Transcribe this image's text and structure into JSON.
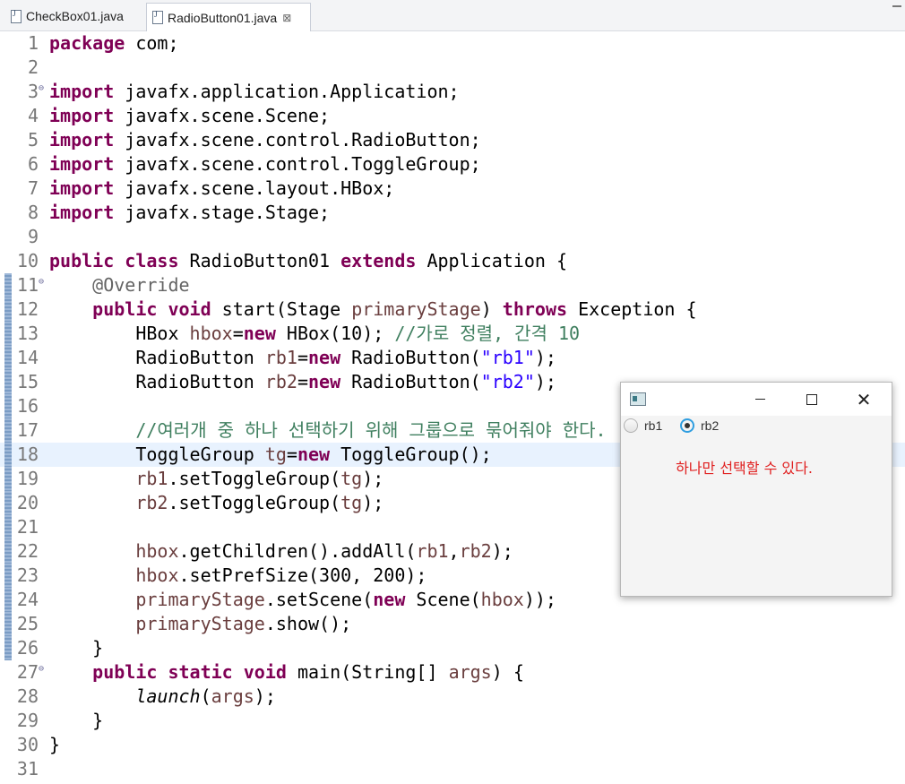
{
  "tabs": [
    {
      "label": "CheckBox01.java",
      "active": false
    },
    {
      "label": "RadioButton01.java",
      "active": true,
      "close": "⊠"
    }
  ],
  "editor": {
    "lines": [
      {
        "no": "1",
        "html": "<span class=\"kw\">package</span> com;"
      },
      {
        "no": "2",
        "html": ""
      },
      {
        "no": "3",
        "fold": true,
        "html": "<span class=\"kw\">import</span> javafx.application.Application;"
      },
      {
        "no": "4",
        "html": "<span class=\"kw\">import</span> javafx.scene.Scene;"
      },
      {
        "no": "5",
        "html": "<span class=\"kw\">import</span> javafx.scene.control.RadioButton;"
      },
      {
        "no": "6",
        "html": "<span class=\"kw\">import</span> javafx.scene.control.ToggleGroup;"
      },
      {
        "no": "7",
        "html": "<span class=\"kw\">import</span> javafx.scene.layout.HBox;"
      },
      {
        "no": "8",
        "html": "<span class=\"kw\">import</span> javafx.stage.Stage;"
      },
      {
        "no": "9",
        "html": ""
      },
      {
        "no": "10",
        "html": "<span class=\"kw\">public</span> <span class=\"kw\">class</span> RadioButton01 <span class=\"kw\">extends</span> Application {"
      },
      {
        "no": "11",
        "fold": true,
        "changed": true,
        "html": "    <span class=\"ann\">@Override</span>"
      },
      {
        "no": "12",
        "changed": true,
        "html": "    <span class=\"kw\">public</span> <span class=\"kw\">void</span> start(Stage <span class=\"var\">primaryStage</span>) <span class=\"kw\">throws</span> Exception {"
      },
      {
        "no": "13",
        "changed": true,
        "html": "        HBox <span class=\"var\">hbox</span>=<span class=\"kw\">new</span> HBox(10); <span class=\"cmt\">//가로 정렬, 간격 10</span>"
      },
      {
        "no": "14",
        "changed": true,
        "html": "        RadioButton <span class=\"var\">rb1</span>=<span class=\"kw\">new</span> RadioButton(<span class=\"str\">\"rb1\"</span>);"
      },
      {
        "no": "15",
        "changed": true,
        "html": "        RadioButton <span class=\"var\">rb2</span>=<span class=\"kw\">new</span> RadioButton(<span class=\"str\">\"rb2\"</span>);"
      },
      {
        "no": "16",
        "changed": true,
        "html": ""
      },
      {
        "no": "17",
        "changed": true,
        "html": "        <span class=\"cmt\">//여러개 중 하나 선택하기 위해 그룹으로 묶어줘야 한다.</span>"
      },
      {
        "no": "18",
        "changed": true,
        "current": true,
        "html": "        ToggleGroup <span class=\"var\">tg</span>=<span class=\"kw\">new</span> ToggleGroup();"
      },
      {
        "no": "19",
        "changed": true,
        "html": "        <span class=\"var\">rb1</span>.setToggleGroup(<span class=\"var\">tg</span>);"
      },
      {
        "no": "20",
        "changed": true,
        "html": "        <span class=\"var\">rb2</span>.setToggleGroup(<span class=\"var\">tg</span>);"
      },
      {
        "no": "21",
        "changed": true,
        "html": ""
      },
      {
        "no": "22",
        "changed": true,
        "html": "        <span class=\"var\">hbox</span>.getChildren().addAll(<span class=\"var\">rb1</span>,<span class=\"var\">rb2</span>);"
      },
      {
        "no": "23",
        "changed": true,
        "html": "        <span class=\"var\">hbox</span>.setPrefSize(300, 200);"
      },
      {
        "no": "24",
        "changed": true,
        "html": "        <span class=\"var\">primaryStage</span>.setScene(<span class=\"kw\">new</span> Scene(<span class=\"var\">hbox</span>));"
      },
      {
        "no": "25",
        "changed": true,
        "html": "        <span class=\"var\">primaryStage</span>.show();"
      },
      {
        "no": "26",
        "changed": true,
        "html": "    }"
      },
      {
        "no": "27",
        "fold": true,
        "html": "    <span class=\"kw\">public</span> <span class=\"kw\">static</span> <span class=\"kw\">void</span> main(String[] <span class=\"var\">args</span>) {"
      },
      {
        "no": "28",
        "html": "        <span class=\"ital\">launch</span>(<span class=\"var\">args</span>);"
      },
      {
        "no": "29",
        "html": "    }"
      },
      {
        "no": "30",
        "html": "}"
      },
      {
        "no": "31",
        "html": ""
      }
    ]
  },
  "fx_window": {
    "minimize": "—",
    "close": "✕",
    "radios": [
      {
        "label": "rb1",
        "selected": false
      },
      {
        "label": "rb2",
        "selected": true
      }
    ],
    "note": "하나만 선택할 수 있다."
  },
  "colors": {
    "keyword": "#7f0055",
    "string": "#2a00ff",
    "comment": "#3f7f5f",
    "note": "#e02020",
    "current_line": "#e8f2fe"
  }
}
